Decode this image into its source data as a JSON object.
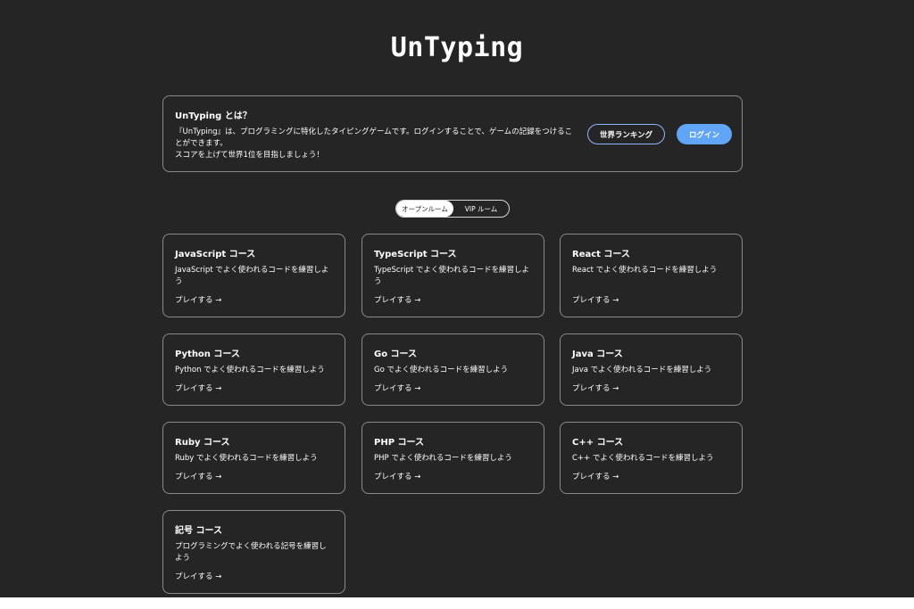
{
  "app": {
    "title": "UnTyping"
  },
  "about": {
    "heading": "UnTyping とは？",
    "description_line1": "『UnTyping』は、プログラミングに特化したタイピングゲームです。ログインすることで、ゲームの記録をつけることができます。",
    "description_line2": "スコアを上げて世界1位を目指しましょう！",
    "ranking_button": "世界ランキング",
    "login_button": "ログイン"
  },
  "rooms": {
    "tabs": [
      {
        "label": "オープンルーム",
        "selected": true
      },
      {
        "label": "VIP ルーム",
        "selected": false
      }
    ]
  },
  "courses": [
    {
      "title": "JavaScript コース",
      "description": "JavaScript でよく使われるコードを練習しよう",
      "play": "プレイする →"
    },
    {
      "title": "TypeScript コース",
      "description": "TypeScript でよく使われるコードを練習しよう",
      "play": "プレイする →"
    },
    {
      "title": "React コース",
      "description": "React でよく使われるコードを練習しよう",
      "play": "プレイする →"
    },
    {
      "title": "Python コース",
      "description": "Python でよく使われるコードを練習しよう",
      "play": "プレイする →"
    },
    {
      "title": "Go コース",
      "description": "Go でよく使われるコードを練習しよう",
      "play": "プレイする →"
    },
    {
      "title": "Java コース",
      "description": "Java でよく使われるコードを練習しよう",
      "play": "プレイする →"
    },
    {
      "title": "Ruby コース",
      "description": "Ruby でよく使われるコードを練習しよう",
      "play": "プレイする →"
    },
    {
      "title": "PHP コース",
      "description": "PHP でよく使われるコードを練習しよう",
      "play": "プレイする →"
    },
    {
      "title": "C++ コース",
      "description": "C++ でよく使われるコードを練習しよう",
      "play": "プレイする →"
    },
    {
      "title": "記号 コース",
      "description": "プログラミングでよく使われる記号を練習しよう",
      "play": "プレイする →"
    }
  ],
  "colors": {
    "background": "#252525",
    "text": "#ffffff",
    "border": "#8a8a8a",
    "accent": "#60a5f6"
  }
}
